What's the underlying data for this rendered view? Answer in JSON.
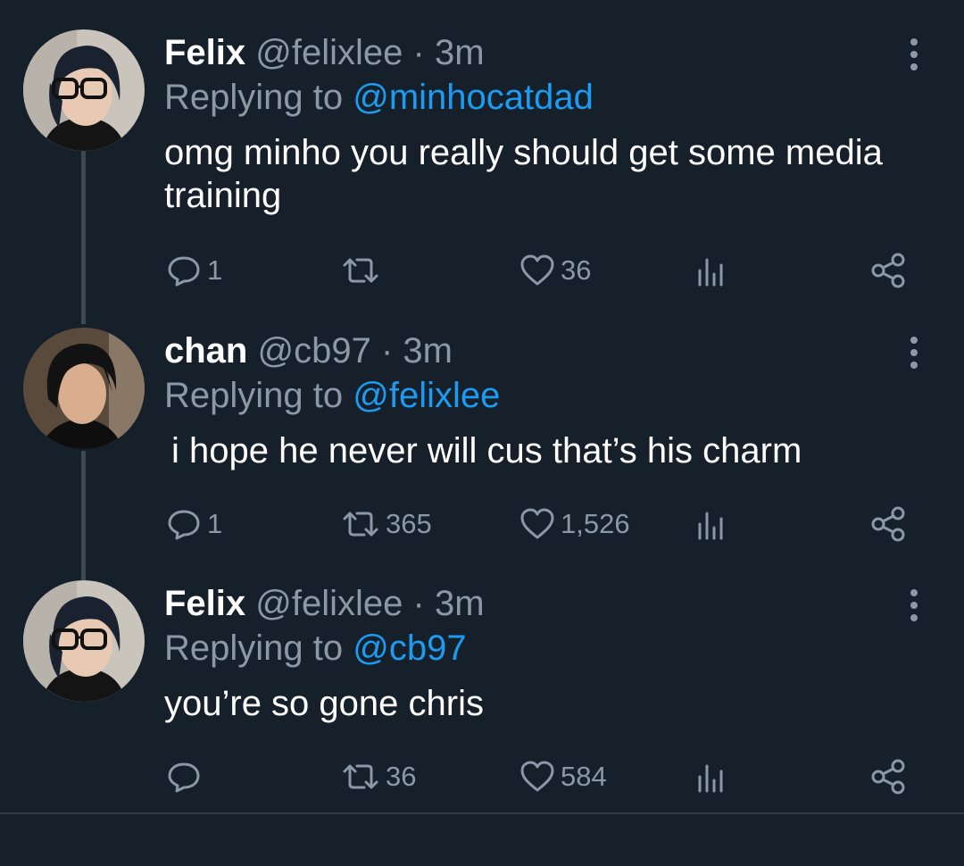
{
  "tweets": [
    {
      "name": "Felix",
      "handle": "@felixlee",
      "time": "3m",
      "replying_prefix": "Replying to ",
      "replying_to": "@minhocatdad",
      "text": "omg minho you really should get some media training",
      "replies": "1",
      "retweets": "",
      "likes": "36"
    },
    {
      "name": "chan",
      "handle": "@cb97",
      "time": "3m",
      "replying_prefix": "Replying to ",
      "replying_to": "@felixlee",
      "text": "i hope he never will cus that’s his charm",
      "replies": "1",
      "retweets": "365",
      "likes": "1,526"
    },
    {
      "name": "Felix",
      "handle": "@felixlee",
      "time": "3m",
      "replying_prefix": "Replying to ",
      "replying_to": "@cb97",
      "text": "you’re so gone chris",
      "replies": "",
      "retweets": "36",
      "likes": "584"
    }
  ],
  "theme": {
    "background": "#15202b",
    "primary_text": "#ffffff",
    "secondary_text": "#8b98a5",
    "link": "#1d9bf0"
  }
}
